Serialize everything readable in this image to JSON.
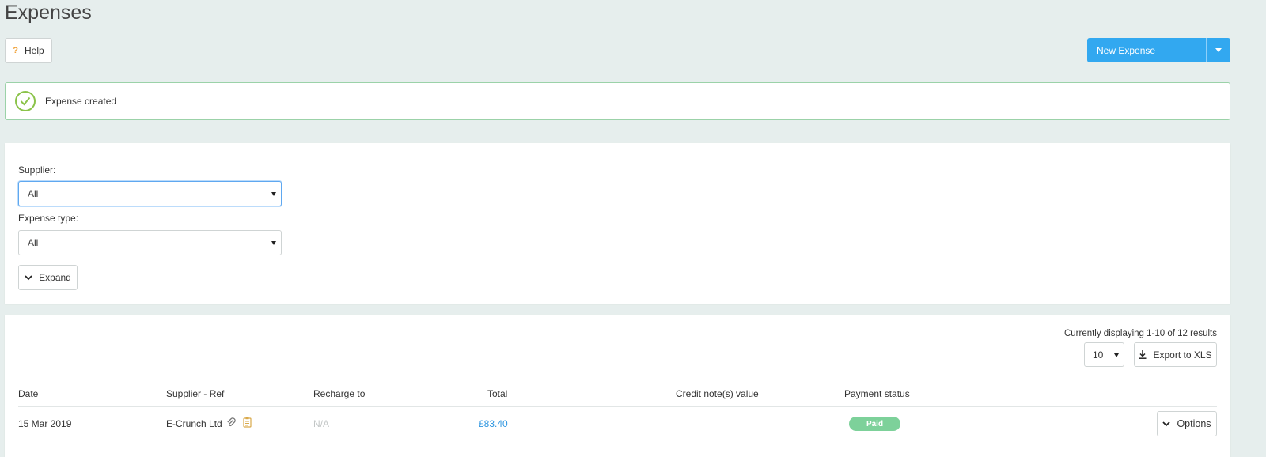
{
  "page": {
    "title": "Expenses"
  },
  "toolbar": {
    "help_label": "Help",
    "new_expense_label": "New Expense"
  },
  "alert": {
    "message": "Expense created"
  },
  "filters": {
    "supplier_label": "Supplier:",
    "supplier_value": "All",
    "expense_type_label": "Expense type:",
    "expense_type_value": "All",
    "expand_label": "Expand"
  },
  "results": {
    "count_text": "Currently displaying 1-10 of 12 results",
    "per_page": "10",
    "export_label": "Export to XLS",
    "columns": [
      "Date",
      "Supplier - Ref",
      "Recharge to",
      "Total",
      "Credit note(s) value",
      "Payment status"
    ],
    "rows": [
      {
        "date": "15 Mar 2019",
        "supplier": "E-Crunch Ltd",
        "recharge": "N/A",
        "total": "£83.40",
        "credit_note": "",
        "status": "Paid",
        "options_label": "Options"
      }
    ]
  },
  "colors": {
    "accent": "#32a8f0",
    "success": "#8bc34a",
    "paid_badge": "#7dd19a",
    "link": "#2f96e0"
  }
}
